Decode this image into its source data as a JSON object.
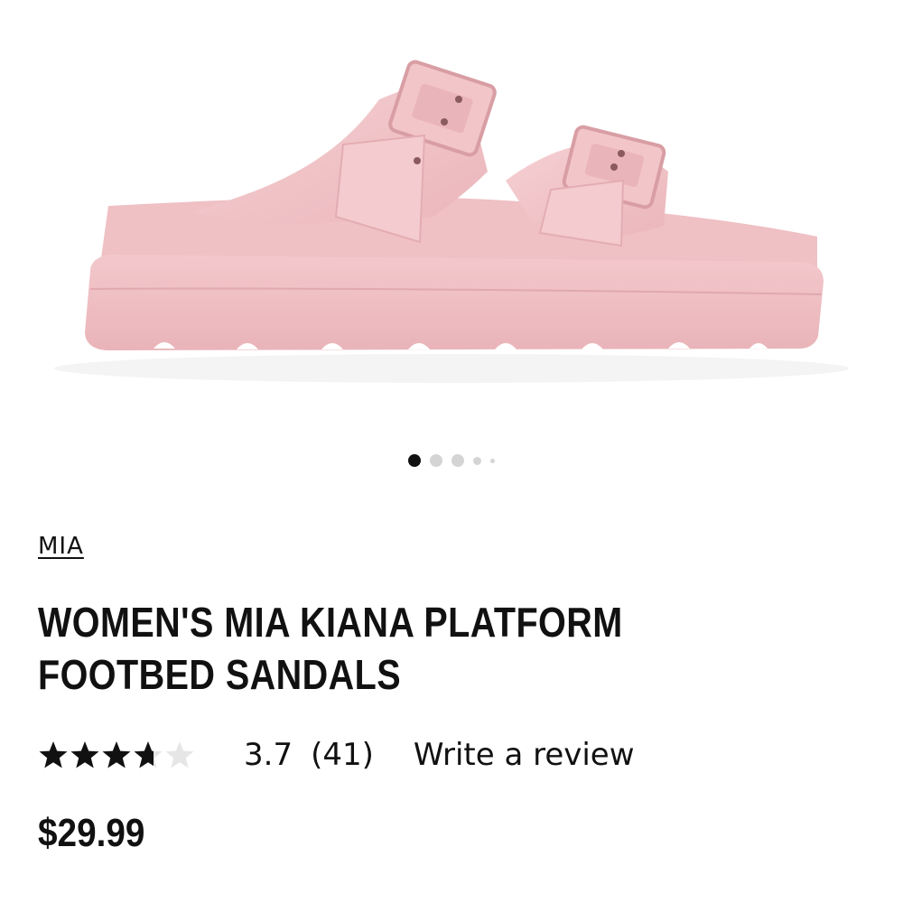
{
  "product": {
    "brand": "MIA",
    "title_line1": "WOMEN'S MIA KIANA PLATFORM",
    "title_line2": "FOOTBED SANDALS",
    "rating": 3.7,
    "rating_text": "3.7",
    "review_count_text": "(41)",
    "write_review_label": "Write a review",
    "price": "$29.99",
    "image_icon": "pink-platform-sandal-image",
    "colors": {
      "sandal": "#f0c2c6",
      "star": "#111111",
      "star_empty": "#e6e6e6"
    }
  },
  "carousel": {
    "total": 5,
    "active_index": 0
  }
}
